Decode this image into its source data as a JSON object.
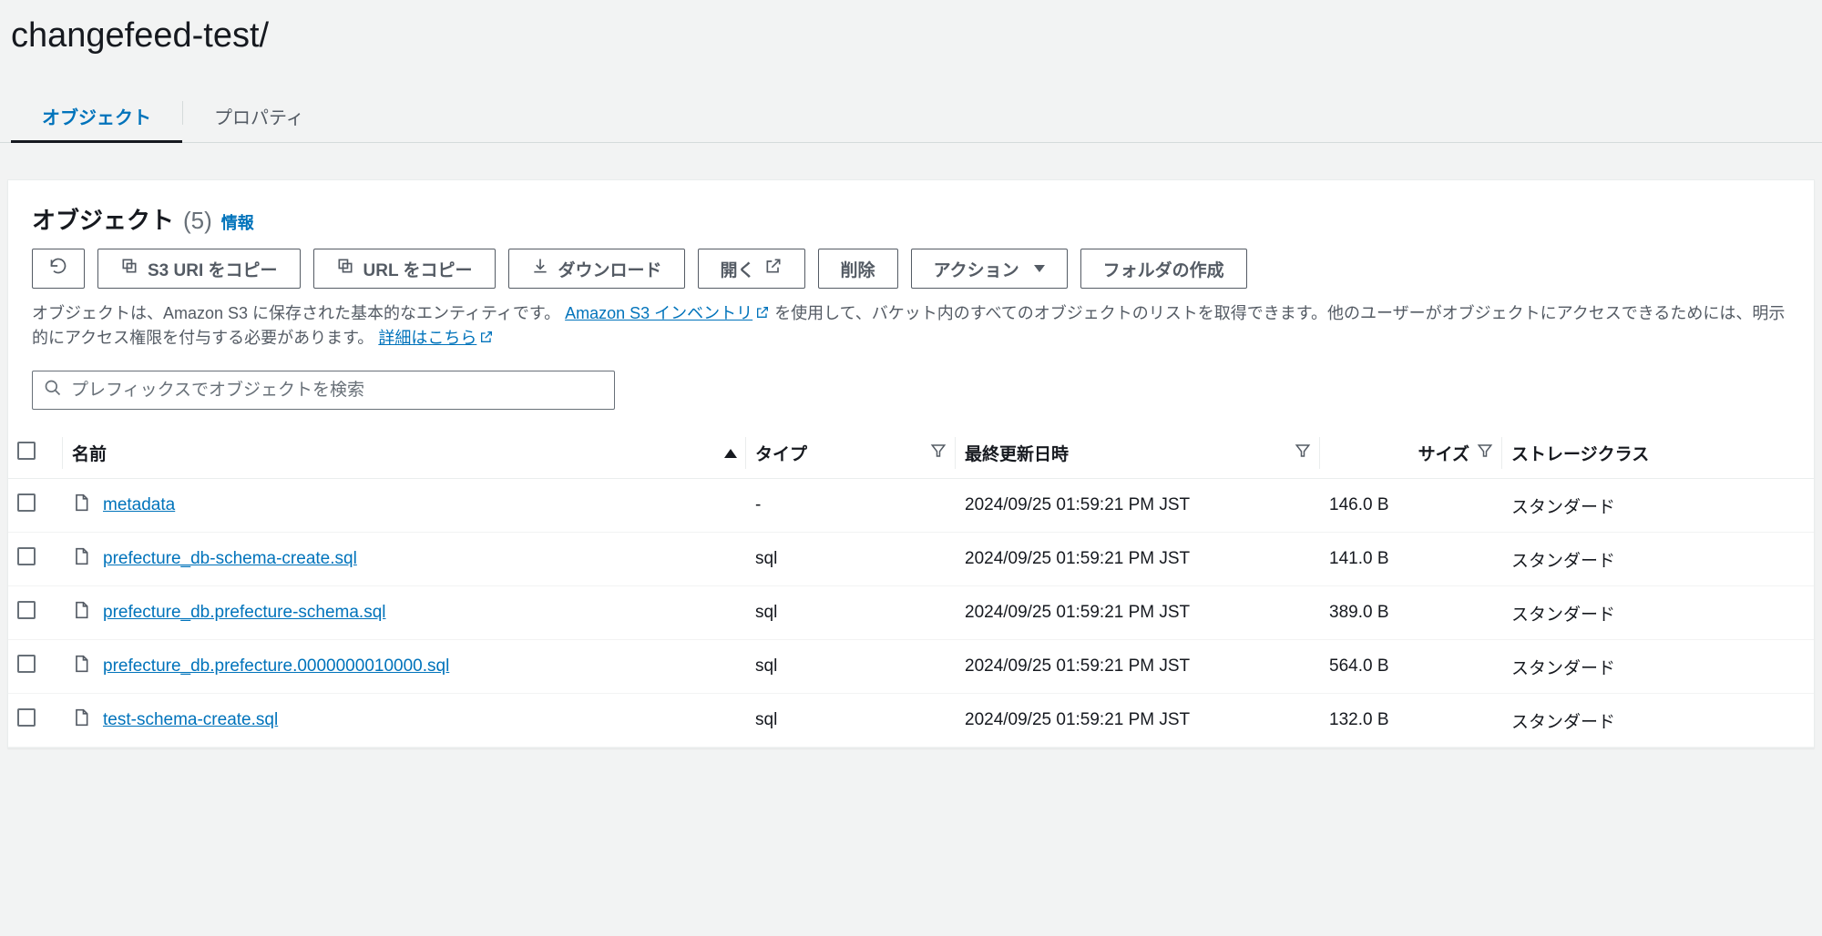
{
  "header": {
    "title": "changefeed-test/"
  },
  "tabs": {
    "objects": "オブジェクト",
    "properties": "プロパティ"
  },
  "panel": {
    "title": "オブジェクト",
    "count": "(5)",
    "info": "情報"
  },
  "toolbar": {
    "copy_s3_uri": "S3 URI をコピー",
    "copy_url": "URL をコピー",
    "download": "ダウンロード",
    "open": "開く",
    "delete": "削除",
    "actions": "アクション",
    "create_folder": "フォルダの作成"
  },
  "description": {
    "part1": "オブジェクトは、Amazon S3 に保存された基本的なエンティティです。",
    "inventory_link": "Amazon S3 インベントリ",
    "part2": "を使用して、バケット内のすべてのオブジェクトのリストを取得できます。他のユーザーがオブジェクトにアクセスできるためには、明示的にアクセス権限を付与する必要があります。",
    "learn_more": "詳細はこちら"
  },
  "search": {
    "placeholder": "プレフィックスでオブジェクトを検索"
  },
  "columns": {
    "name": "名前",
    "type": "タイプ",
    "last_modified": "最終更新日時",
    "size": "サイズ",
    "storage_class": "ストレージクラス"
  },
  "rows": [
    {
      "name": "metadata",
      "type": "-",
      "last_modified": "2024/09/25 01:59:21 PM JST",
      "size": "146.0 B",
      "storage_class": "スタンダード"
    },
    {
      "name": "prefecture_db-schema-create.sql",
      "type": "sql",
      "last_modified": "2024/09/25 01:59:21 PM JST",
      "size": "141.0 B",
      "storage_class": "スタンダード"
    },
    {
      "name": "prefecture_db.prefecture-schema.sql",
      "type": "sql",
      "last_modified": "2024/09/25 01:59:21 PM JST",
      "size": "389.0 B",
      "storage_class": "スタンダード"
    },
    {
      "name": "prefecture_db.prefecture.0000000010000.sql",
      "type": "sql",
      "last_modified": "2024/09/25 01:59:21 PM JST",
      "size": "564.0 B",
      "storage_class": "スタンダード"
    },
    {
      "name": "test-schema-create.sql",
      "type": "sql",
      "last_modified": "2024/09/25 01:59:21 PM JST",
      "size": "132.0 B",
      "storage_class": "スタンダード"
    }
  ]
}
